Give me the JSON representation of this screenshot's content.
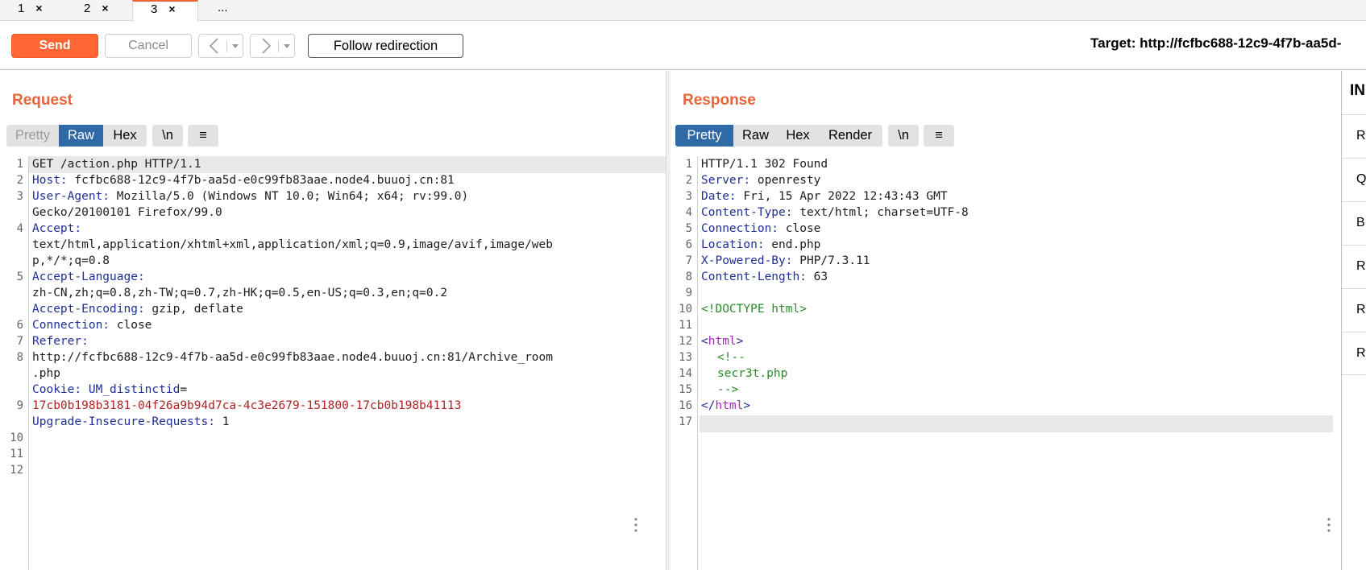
{
  "tabs": [
    {
      "label": "1",
      "close": "×"
    },
    {
      "label": "2",
      "close": "×"
    },
    {
      "label": "3",
      "close": "×"
    },
    {
      "label": "..."
    }
  ],
  "toolbar": {
    "send_label": "Send",
    "cancel_label": "Cancel",
    "follow_label": "Follow redirection",
    "target_text": "Target: http://fcfbc688-12c9-4f7b-aa5d-"
  },
  "request": {
    "title": "Request",
    "modes": [
      "Pretty",
      "Raw",
      "Hex",
      "\\n",
      "≡"
    ],
    "active_mode": "Raw",
    "line_numbers": [
      "1",
      "2",
      "3",
      "4",
      "5",
      "6",
      "7",
      "8",
      "9",
      "10",
      "11",
      "12"
    ],
    "lines": [
      {
        "name": "",
        "value": "GET /action.php HTTP/1.1"
      },
      {
        "name": "Host:",
        "value": " fcfbc688-12c9-4f7b-aa5d-e0c99fb83aae.node4.buuoj.cn:81"
      },
      {
        "name": "User-Agent:",
        "value": " Mozilla/5.0 (Windows NT 10.0; Win64; x64; rv:99.0)"
      },
      {
        "name": "",
        "value": "Gecko/20100101 Firefox/99.0"
      },
      {
        "name": "Accept:",
        "value": ""
      },
      {
        "name": "",
        "value": "text/html,application/xhtml+xml,application/xml;q=0.9,image/avif,image/web"
      },
      {
        "name": "",
        "value": "p,*/*;q=0.8"
      },
      {
        "name": "Accept-Language:",
        "value": ""
      },
      {
        "name": "",
        "value": "zh-CN,zh;q=0.8,zh-TW;q=0.7,zh-HK;q=0.5,en-US;q=0.3,en;q=0.2"
      },
      {
        "name": "Accept-Encoding:",
        "value": " gzip, deflate"
      },
      {
        "name": "Connection:",
        "value": " close"
      },
      {
        "name": "Referer:",
        "value": ""
      },
      {
        "name": "",
        "value": "http://fcfbc688-12c9-4f7b-aa5d-e0c99fb83aae.node4.buuoj.cn:81/Archive_room"
      },
      {
        "name": "",
        "value": ".php"
      },
      {
        "name": "Cookie:",
        "value": " ",
        "cookie_name": "UM_distinctid",
        "eq": "="
      },
      {
        "name": "",
        "cookie_value": "17cb0b198b3181-04f26a9b94d7ca-4c3e2679-151800-17cb0b198b41113"
      },
      {
        "name": "Upgrade-Insecure-Requests:",
        "value": " 1"
      }
    ]
  },
  "response": {
    "title": "Response",
    "modes": [
      "Pretty",
      "Raw",
      "Hex",
      "Render",
      "\\n",
      "≡"
    ],
    "active_mode": "Pretty",
    "line_numbers": [
      "1",
      "2",
      "3",
      "4",
      "5",
      "6",
      "7",
      "8",
      "9",
      "10",
      "11",
      "12",
      "13",
      "14",
      "15",
      "16",
      "17"
    ],
    "headers": [
      {
        "name": "",
        "value": "HTTP/1.1 302 Found"
      },
      {
        "name": "Server:",
        "value": " openresty"
      },
      {
        "name": "Date:",
        "value": " Fri, 15 Apr 2022 12:43:43 GMT"
      },
      {
        "name": "Content-Type:",
        "value": " text/html; charset=UTF-8"
      },
      {
        "name": "Connection:",
        "value": " close"
      },
      {
        "name": "Location:",
        "value": " end.php"
      },
      {
        "name": "X-Powered-By:",
        "value": " PHP/7.3.11"
      },
      {
        "name": "Content-Length:",
        "value": " 63"
      }
    ],
    "body": {
      "doctype": "<!DOCTYPE html>",
      "html_open_lt": "<",
      "html_tag": "html",
      "html_open_gt": ">",
      "comment_open": "<!--",
      "comment_text": "secr3t.php",
      "comment_close": "-->",
      "html_close_lt": "</",
      "html_close_gt": ">"
    }
  },
  "inspector": {
    "title": "IN",
    "rows": [
      "R",
      "Q",
      "B",
      "R",
      "R",
      "R"
    ]
  },
  "colors": {
    "accent": "#ff6633",
    "title_orange": "#e8643a",
    "active_blue": "#2f6aa6",
    "header_name": "#1f2f97",
    "cookie_value": "#b22323",
    "html_tag": "#a328b8",
    "comment": "#2a8c2a"
  }
}
